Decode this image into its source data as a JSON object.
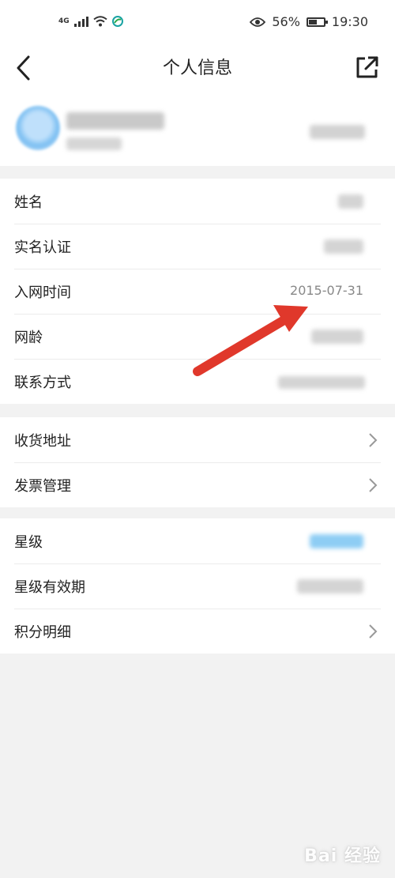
{
  "status_bar": {
    "network_label": "4G",
    "battery_percent": "56%",
    "time": "19:30",
    "battery_level": 0.56,
    "icons": [
      "cellular-signal-icon",
      "wifi-icon",
      "carrier-app-icon",
      "eye-icon",
      "battery-icon"
    ]
  },
  "header": {
    "title": "个人信息",
    "back_icon": "chevron-left-icon",
    "share_icon": "external-share-icon"
  },
  "groups": [
    {
      "rows": [
        {
          "label": "姓名",
          "value": ""
        },
        {
          "label": "实名认证",
          "value": ""
        },
        {
          "label": "入网时间",
          "value": "2015-07-31"
        },
        {
          "label": "网龄",
          "value": ""
        },
        {
          "label": "联系方式",
          "value": ""
        }
      ]
    },
    {
      "rows": [
        {
          "label": "收货地址"
        },
        {
          "label": "发票管理"
        }
      ]
    },
    {
      "rows": [
        {
          "label": "星级",
          "value": ""
        },
        {
          "label": "星级有效期",
          "value": ""
        },
        {
          "label": "积分明细"
        }
      ]
    }
  ],
  "colors": {
    "background": "#f2f2f2",
    "card": "#ffffff",
    "annotation_arrow": "#e0382b",
    "star_level_blur": "#8ecdf4"
  },
  "watermark": {
    "text": "Bai 经验"
  }
}
